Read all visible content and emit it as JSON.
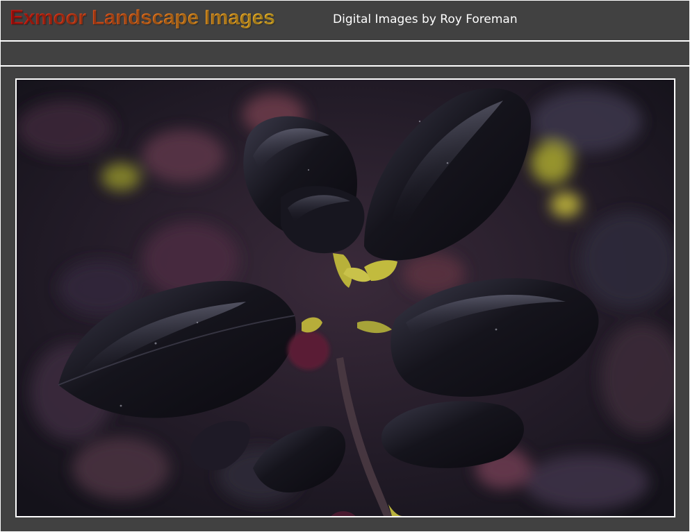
{
  "header": {
    "title": "Exmoor Landscape Images",
    "subtitle": "Digital Images by Roy Foreman"
  },
  "colors": {
    "background": "#414141",
    "title_gradient_start": "#d4140f",
    "title_gradient_end": "#f9c42a",
    "subtitle_text": "#ffffff",
    "frame_border": "#ffffff"
  },
  "main": {
    "photo_subject": "dark purple leaves plant photograph"
  }
}
